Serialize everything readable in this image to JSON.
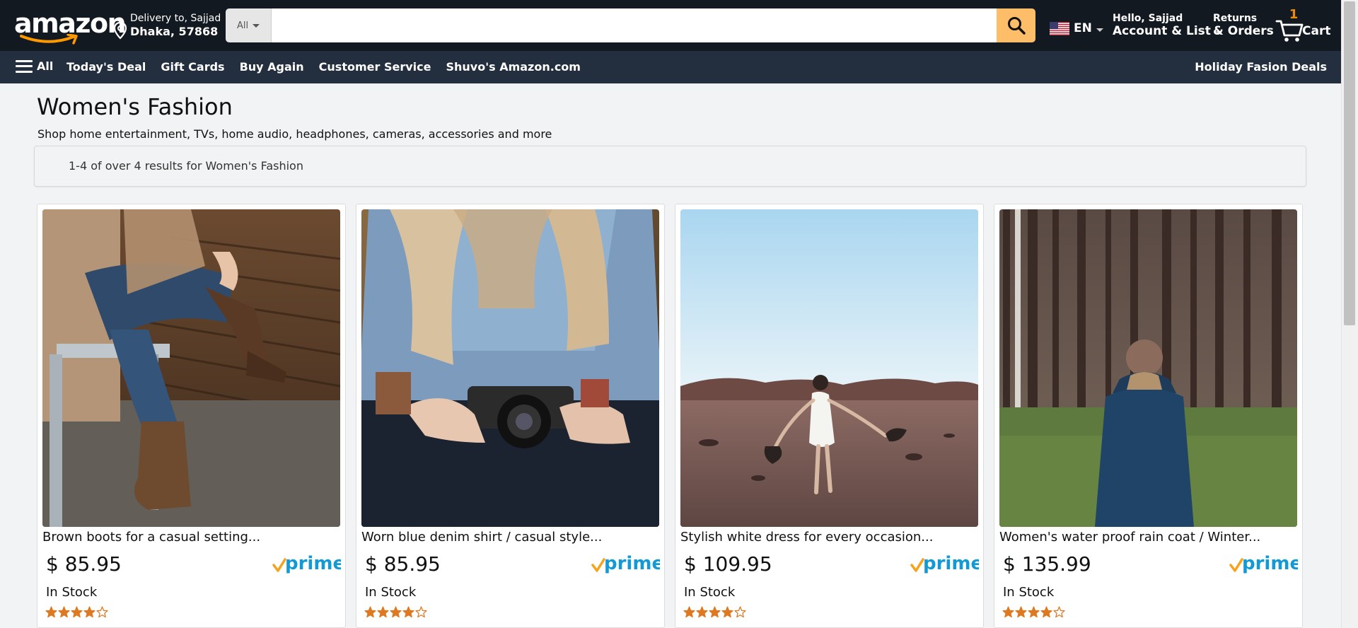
{
  "header": {
    "logo_text": "amazon",
    "delivery_line1": "Delivery to, Sajjad",
    "delivery_line2": "Dhaka, 57868",
    "search_category": "All",
    "search_placeholder": "",
    "language": "EN",
    "account_line1": "Hello, Sajjad",
    "account_line2": "Account & List",
    "returns_line1": "Returns",
    "returns_line2": "& Orders",
    "cart_count": "1",
    "cart_label": "Cart"
  },
  "nav": {
    "all_label": "All",
    "links": [
      "Today's Deal",
      "Gift Cards",
      "Buy Again",
      "Customer Service",
      "Shuvo's Amazon.com"
    ],
    "right_link": "Holiday Fasion Deals"
  },
  "page": {
    "title": "Women's Fashion",
    "subtitle": "Shop home entertainment, TVs, home audio, headphones, cameras, accessories and more",
    "results_text": "1-4 of over 4 results for Women's Fashion"
  },
  "products": [
    {
      "title": "Brown boots for a casual setting...",
      "price": "$ 85.95",
      "stock": "In Stock",
      "rating": 4,
      "prime": "prime"
    },
    {
      "title": "Worn blue denim shirt / casual style...",
      "price": "$ 85.95",
      "stock": "In Stock",
      "rating": 4,
      "prime": "prime"
    },
    {
      "title": "Stylish white dress for every occasion...",
      "price": "$ 109.95",
      "stock": "In Stock",
      "rating": 4,
      "prime": "prime"
    },
    {
      "title": "Women's water proof rain coat / Winter...",
      "price": "$ 135.99",
      "stock": "In Stock",
      "rating": 4,
      "prime": "prime"
    }
  ],
  "colors": {
    "header_bg": "#131921",
    "nav_bg": "#232f3e",
    "search_button": "#febd69",
    "cart_count": "#f08804",
    "star": "#de7921",
    "prime_blue": "#1399d4",
    "prime_check": "#f7a21b"
  },
  "icons": {
    "location": "pin-icon",
    "search": "search-icon",
    "flag": "us-flag-icon",
    "cart": "cart-icon",
    "menu": "hamburger-icon",
    "star": "star-icon"
  }
}
